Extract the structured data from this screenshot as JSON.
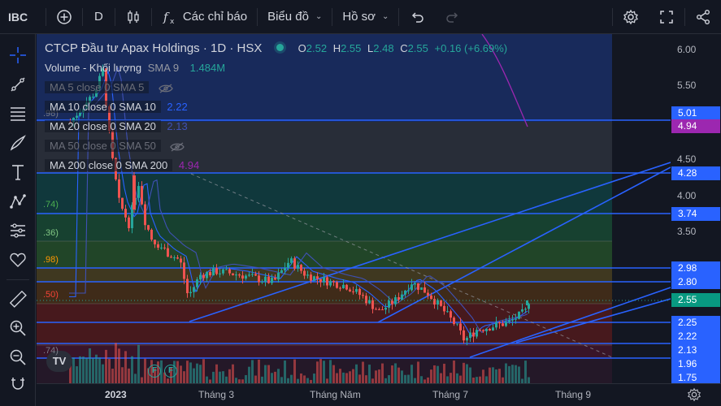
{
  "topbar": {
    "symbol": "IBC",
    "interval": "D",
    "indicators_label": "Các chỉ báo",
    "chart_label": "Biểu đồ",
    "profile_label": "Hồ sơ"
  },
  "legend": {
    "title": "CTCP Đầu tư Apax Holdings · 1D · HSX",
    "o_key": "O",
    "o_val": "2.52",
    "h_key": "H",
    "h_val": "2.55",
    "l_key": "L",
    "l_val": "2.48",
    "c_key": "C",
    "c_val": "2.55",
    "change": "+0.16 (+6.69%)",
    "volume_label": "Volume - Khối lượng",
    "volume_sma": "SMA 9",
    "volume_value": "1.484M",
    "ma5": "MA 5 close 0 SMA 5",
    "ma10": "MA 10 close 0 SMA 10",
    "ma10_value": "2.22",
    "ma20": "MA 20 close 0 SMA 20",
    "ma20_value": "2.13",
    "ma50": "MA 50 close 0 SMA 50",
    "ma200": "MA 200 close 0 SMA 200",
    "ma200_value": "4.94"
  },
  "fib_left_labels": [
    ".98)",
    ".74)",
    ".36)",
    ".98)",
    ".50)",
    ".74)"
  ],
  "price_axis": {
    "labels": [
      "6.00",
      "5.50",
      "4.50",
      "4.00",
      "3.50"
    ],
    "badges": [
      {
        "text": "5.01",
        "color": "#2962ff"
      },
      {
        "text": "4.94",
        "color": "#9c27b0"
      },
      {
        "text": "4.28",
        "color": "#2962ff"
      },
      {
        "text": "3.74",
        "color": "#2962ff"
      },
      {
        "text": "2.98",
        "color": "#2962ff"
      },
      {
        "text": "2.80",
        "color": "#2962ff"
      },
      {
        "text": "2.55",
        "color": "#089981"
      },
      {
        "text": "2.25",
        "color": "#2962ff"
      },
      {
        "text": "2.22",
        "color": "#2962ff"
      },
      {
        "text": "2.13",
        "color": "#2962ff"
      },
      {
        "text": "1.96",
        "color": "#2962ff"
      },
      {
        "text": "1.75",
        "color": "#2962ff"
      }
    ]
  },
  "time_axis": [
    "2023",
    "Tháng 3",
    "Tháng Năm",
    "Tháng 7",
    "Tháng 9"
  ],
  "chart_data": {
    "type": "candlestick",
    "symbol": "IBC",
    "interval": "1D",
    "exchange": "HSX",
    "ylim": [
      1.7,
      6.2
    ],
    "last": {
      "open": 2.52,
      "high": 2.55,
      "low": 2.48,
      "close": 2.55
    },
    "horizontal_levels": [
      5.01,
      4.28,
      3.74,
      2.98,
      2.8,
      2.25,
      2.13,
      1.96
    ],
    "ma200_last": 4.94,
    "ma10_last": 2.22,
    "ma20_last": 2.13,
    "colors": {
      "up": "#26a69a",
      "down": "#ef5350",
      "level": "#2962ff",
      "ma200": "#9c27b0"
    }
  },
  "logo": "TV"
}
